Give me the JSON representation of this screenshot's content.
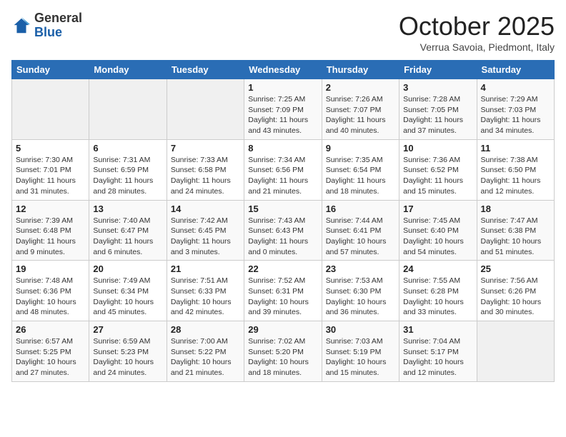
{
  "logo": {
    "general": "General",
    "blue": "Blue"
  },
  "header": {
    "month": "October 2025",
    "subtitle": "Verrua Savoia, Piedmont, Italy"
  },
  "weekdays": [
    "Sunday",
    "Monday",
    "Tuesday",
    "Wednesday",
    "Thursday",
    "Friday",
    "Saturday"
  ],
  "weeks": [
    [
      {
        "day": "",
        "info": ""
      },
      {
        "day": "",
        "info": ""
      },
      {
        "day": "",
        "info": ""
      },
      {
        "day": "1",
        "info": "Sunrise: 7:25 AM\nSunset: 7:09 PM\nDaylight: 11 hours\nand 43 minutes."
      },
      {
        "day": "2",
        "info": "Sunrise: 7:26 AM\nSunset: 7:07 PM\nDaylight: 11 hours\nand 40 minutes."
      },
      {
        "day": "3",
        "info": "Sunrise: 7:28 AM\nSunset: 7:05 PM\nDaylight: 11 hours\nand 37 minutes."
      },
      {
        "day": "4",
        "info": "Sunrise: 7:29 AM\nSunset: 7:03 PM\nDaylight: 11 hours\nand 34 minutes."
      }
    ],
    [
      {
        "day": "5",
        "info": "Sunrise: 7:30 AM\nSunset: 7:01 PM\nDaylight: 11 hours\nand 31 minutes."
      },
      {
        "day": "6",
        "info": "Sunrise: 7:31 AM\nSunset: 6:59 PM\nDaylight: 11 hours\nand 28 minutes."
      },
      {
        "day": "7",
        "info": "Sunrise: 7:33 AM\nSunset: 6:58 PM\nDaylight: 11 hours\nand 24 minutes."
      },
      {
        "day": "8",
        "info": "Sunrise: 7:34 AM\nSunset: 6:56 PM\nDaylight: 11 hours\nand 21 minutes."
      },
      {
        "day": "9",
        "info": "Sunrise: 7:35 AM\nSunset: 6:54 PM\nDaylight: 11 hours\nand 18 minutes."
      },
      {
        "day": "10",
        "info": "Sunrise: 7:36 AM\nSunset: 6:52 PM\nDaylight: 11 hours\nand 15 minutes."
      },
      {
        "day": "11",
        "info": "Sunrise: 7:38 AM\nSunset: 6:50 PM\nDaylight: 11 hours\nand 12 minutes."
      }
    ],
    [
      {
        "day": "12",
        "info": "Sunrise: 7:39 AM\nSunset: 6:48 PM\nDaylight: 11 hours\nand 9 minutes."
      },
      {
        "day": "13",
        "info": "Sunrise: 7:40 AM\nSunset: 6:47 PM\nDaylight: 11 hours\nand 6 minutes."
      },
      {
        "day": "14",
        "info": "Sunrise: 7:42 AM\nSunset: 6:45 PM\nDaylight: 11 hours\nand 3 minutes."
      },
      {
        "day": "15",
        "info": "Sunrise: 7:43 AM\nSunset: 6:43 PM\nDaylight: 11 hours\nand 0 minutes."
      },
      {
        "day": "16",
        "info": "Sunrise: 7:44 AM\nSunset: 6:41 PM\nDaylight: 10 hours\nand 57 minutes."
      },
      {
        "day": "17",
        "info": "Sunrise: 7:45 AM\nSunset: 6:40 PM\nDaylight: 10 hours\nand 54 minutes."
      },
      {
        "day": "18",
        "info": "Sunrise: 7:47 AM\nSunset: 6:38 PM\nDaylight: 10 hours\nand 51 minutes."
      }
    ],
    [
      {
        "day": "19",
        "info": "Sunrise: 7:48 AM\nSunset: 6:36 PM\nDaylight: 10 hours\nand 48 minutes."
      },
      {
        "day": "20",
        "info": "Sunrise: 7:49 AM\nSunset: 6:34 PM\nDaylight: 10 hours\nand 45 minutes."
      },
      {
        "day": "21",
        "info": "Sunrise: 7:51 AM\nSunset: 6:33 PM\nDaylight: 10 hours\nand 42 minutes."
      },
      {
        "day": "22",
        "info": "Sunrise: 7:52 AM\nSunset: 6:31 PM\nDaylight: 10 hours\nand 39 minutes."
      },
      {
        "day": "23",
        "info": "Sunrise: 7:53 AM\nSunset: 6:30 PM\nDaylight: 10 hours\nand 36 minutes."
      },
      {
        "day": "24",
        "info": "Sunrise: 7:55 AM\nSunset: 6:28 PM\nDaylight: 10 hours\nand 33 minutes."
      },
      {
        "day": "25",
        "info": "Sunrise: 7:56 AM\nSunset: 6:26 PM\nDaylight: 10 hours\nand 30 minutes."
      }
    ],
    [
      {
        "day": "26",
        "info": "Sunrise: 6:57 AM\nSunset: 5:25 PM\nDaylight: 10 hours\nand 27 minutes."
      },
      {
        "day": "27",
        "info": "Sunrise: 6:59 AM\nSunset: 5:23 PM\nDaylight: 10 hours\nand 24 minutes."
      },
      {
        "day": "28",
        "info": "Sunrise: 7:00 AM\nSunset: 5:22 PM\nDaylight: 10 hours\nand 21 minutes."
      },
      {
        "day": "29",
        "info": "Sunrise: 7:02 AM\nSunset: 5:20 PM\nDaylight: 10 hours\nand 18 minutes."
      },
      {
        "day": "30",
        "info": "Sunrise: 7:03 AM\nSunset: 5:19 PM\nDaylight: 10 hours\nand 15 minutes."
      },
      {
        "day": "31",
        "info": "Sunrise: 7:04 AM\nSunset: 5:17 PM\nDaylight: 10 hours\nand 12 minutes."
      },
      {
        "day": "",
        "info": ""
      }
    ]
  ]
}
